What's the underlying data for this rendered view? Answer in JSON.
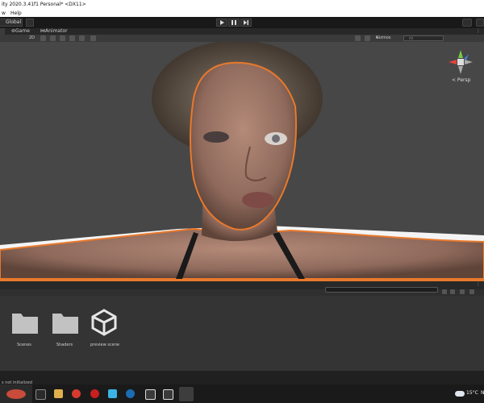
{
  "window": {
    "title": "ity 2020.3.41f1 Personal* <DX11>"
  },
  "menu": {
    "items": [
      "w",
      "Help"
    ]
  },
  "toolbar": {
    "global_label": "Global"
  },
  "tabs": {
    "game": "Game",
    "animator": "Animator"
  },
  "scene_toolbar": {
    "mode_2d": "2D",
    "gizmos": "Gizmos",
    "search_placeholder": "All"
  },
  "gizmo": {
    "projection": "< Persp"
  },
  "project": {
    "assets": [
      {
        "name": "Scenes",
        "icon": "folder-icon"
      },
      {
        "name": "Shaders",
        "icon": "folder-icon"
      },
      {
        "name": "preview scene",
        "icon": "unity-logo-icon"
      }
    ]
  },
  "status": {
    "text": "s not initialized"
  },
  "taskbar": {
    "temperature": "15°C",
    "trailing": "N"
  },
  "colors": {
    "selection_outline": "#e8792c",
    "toolbar_bg": "#191919",
    "viewport_bg": "#474747"
  }
}
